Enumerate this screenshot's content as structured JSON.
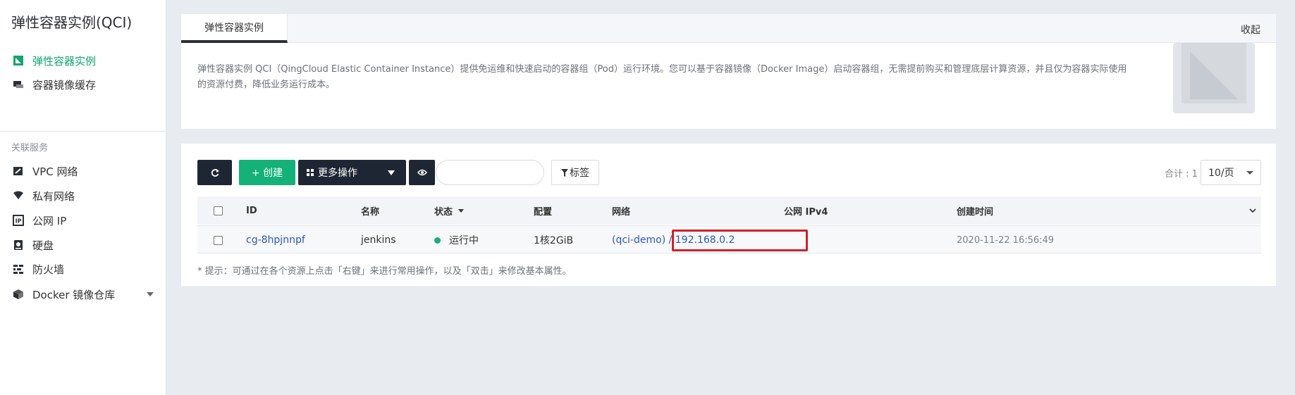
{
  "sidebar": {
    "title": "弹性容器实例(QCI)",
    "primary_items": [
      {
        "label": "弹性容器实例",
        "icon": "container-instance-icon",
        "active": true
      },
      {
        "label": "容器镜像缓存",
        "icon": "image-cache-icon",
        "active": false
      }
    ],
    "section_label": "关联服务",
    "related_items": [
      {
        "label": "VPC 网络",
        "icon": "vpc-icon"
      },
      {
        "label": "私有网络",
        "icon": "wifi-icon"
      },
      {
        "label": "公网 IP",
        "icon": "ip-icon"
      },
      {
        "label": "硬盘",
        "icon": "disk-icon"
      },
      {
        "label": "防火墙",
        "icon": "firewall-icon"
      },
      {
        "label": "Docker 镜像仓库",
        "icon": "docker-box-icon"
      }
    ]
  },
  "intro": {
    "tab_label": "弹性容器实例",
    "collapse_label": "收起",
    "description": "弹性容器实例 QCI（QingCloud Elastic Container Instance）提供免运维和快速启动的容器组（Pod）运行环境。您可以基于容器镜像（Docker Image）启动容器组，无需提前购买和管理底层计算资源，并且仅为容器实际使用的资源付费，降低业务运行成本。"
  },
  "toolbar": {
    "create_label": "+ 创建",
    "more_label": "更多操作",
    "tag_label": "标签",
    "total_label": "合计 : 1",
    "page_size": "10/页"
  },
  "table": {
    "headers": {
      "id": "ID",
      "name": "名称",
      "status": "状态",
      "config": "配置",
      "network": "网络",
      "public_ip": "公网 IPv4",
      "created": "创建时间"
    },
    "rows": [
      {
        "id": "cg-8hpjnnpf",
        "name": "jenkins",
        "status": "运行中",
        "config": "1核2GiB",
        "network": "(qci-demo) / 192.168.0.2",
        "public_ip": "",
        "created": "2020-11-22 16:56:49"
      }
    ]
  },
  "hint": "* 提示：可通过在各个资源上点击「右键」来进行常用操作，以及「双击」来修改基本属性。",
  "colors": {
    "accent_green": "#14b178",
    "dark_button": "#1f2633",
    "link_blue": "#2d56c8",
    "highlight_red": "#d0202a"
  }
}
